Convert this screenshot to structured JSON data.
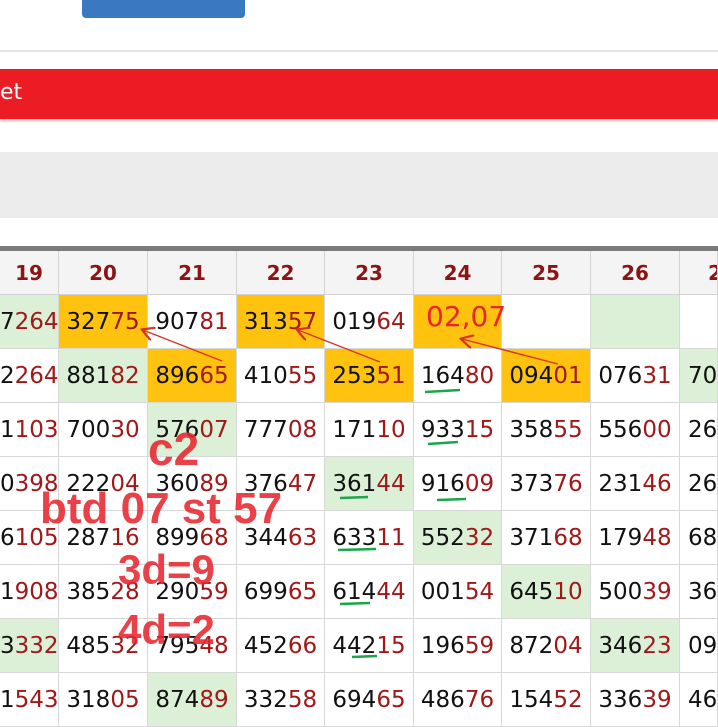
{
  "header": {
    "title_fragment": "et"
  },
  "columns": [
    "19",
    "20",
    "21",
    "22",
    "23",
    "24",
    "25",
    "26",
    "2"
  ],
  "rows": [
    [
      [
        "7",
        "264"
      ],
      [
        "327",
        "75"
      ],
      [
        "907",
        "81"
      ],
      [
        "313",
        "57"
      ],
      [
        "019",
        "64"
      ],
      [
        "",
        ""
      ],
      [
        "",
        ""
      ],
      [
        "",
        ""
      ],
      [
        "",
        ""
      ]
    ],
    [
      [
        "2",
        "264"
      ],
      [
        "881",
        "82"
      ],
      [
        "896",
        "65"
      ],
      [
        "410",
        "55"
      ],
      [
        "253",
        "51"
      ],
      [
        "164",
        "80"
      ],
      [
        "094",
        "01"
      ],
      [
        "076",
        "31"
      ],
      [
        "70",
        ""
      ]
    ],
    [
      [
        "1",
        "103"
      ],
      [
        "700",
        "30"
      ],
      [
        "576",
        "07"
      ],
      [
        "777",
        "08"
      ],
      [
        "171",
        "10"
      ],
      [
        "933",
        "15"
      ],
      [
        "358",
        "55"
      ],
      [
        "556",
        "00"
      ],
      [
        "26",
        ""
      ]
    ],
    [
      [
        "0",
        "398"
      ],
      [
        "222",
        "04"
      ],
      [
        "360",
        "89"
      ],
      [
        "376",
        "47"
      ],
      [
        "361",
        "44"
      ],
      [
        "916",
        "09"
      ],
      [
        "373",
        "76"
      ],
      [
        "231",
        "46"
      ],
      [
        "26",
        ""
      ]
    ],
    [
      [
        "6",
        "105"
      ],
      [
        "287",
        "16"
      ],
      [
        "899",
        "68"
      ],
      [
        "344",
        "63"
      ],
      [
        "633",
        "11"
      ],
      [
        "552",
        "32"
      ],
      [
        "371",
        "68"
      ],
      [
        "179",
        "48"
      ],
      [
        "68",
        ""
      ]
    ],
    [
      [
        "1",
        "908"
      ],
      [
        "385",
        "28"
      ],
      [
        "290",
        "59"
      ],
      [
        "699",
        "65"
      ],
      [
        "614",
        "44"
      ],
      [
        "001",
        "54"
      ],
      [
        "645",
        "10"
      ],
      [
        "500",
        "39"
      ],
      [
        "36",
        ""
      ]
    ],
    [
      [
        "3",
        "332"
      ],
      [
        "485",
        "32"
      ],
      [
        "795",
        "48"
      ],
      [
        "452",
        "66"
      ],
      [
        "442",
        "15"
      ],
      [
        "196",
        "59"
      ],
      [
        "872",
        "04"
      ],
      [
        "346",
        "23"
      ],
      [
        "09",
        ""
      ]
    ],
    [
      [
        "1",
        "543"
      ],
      [
        "318",
        "05"
      ],
      [
        "874",
        "89"
      ],
      [
        "332",
        "58"
      ],
      [
        "694",
        "65"
      ],
      [
        "486",
        "76"
      ],
      [
        "154",
        "52"
      ],
      [
        "336",
        "39"
      ],
      [
        "46",
        ""
      ]
    ]
  ],
  "cell_styles": [
    [
      "g",
      "o",
      "w",
      "o",
      "w",
      "o",
      "w",
      "g",
      "w"
    ],
    [
      "w",
      "g",
      "o",
      "w",
      "o",
      "w",
      "o",
      "w",
      "g"
    ],
    [
      "w",
      "w",
      "g",
      "w",
      "w",
      "w",
      "w",
      "w",
      "w"
    ],
    [
      "w",
      "w",
      "w",
      "w",
      "g",
      "w",
      "w",
      "w",
      "w"
    ],
    [
      "w",
      "w",
      "w",
      "w",
      "w",
      "g",
      "w",
      "w",
      "w"
    ],
    [
      "w",
      "w",
      "w",
      "w",
      "w",
      "w",
      "g",
      "w",
      "w"
    ],
    [
      "g",
      "w",
      "w",
      "w",
      "w",
      "w",
      "w",
      "g",
      "w"
    ],
    [
      "w",
      "w",
      "g",
      "w",
      "w",
      "w",
      "w",
      "w",
      "w"
    ]
  ],
  "annotations": {
    "c2": "c2",
    "btd": "btd 07 st 57",
    "d3": "3d=9",
    "d4": "4d=2",
    "hand": "02,07"
  },
  "colors": {
    "red_bar": "#ec1c24",
    "orange": "#ffc20e",
    "green": "#dcf0d8",
    "digit_red": "#a01818"
  }
}
